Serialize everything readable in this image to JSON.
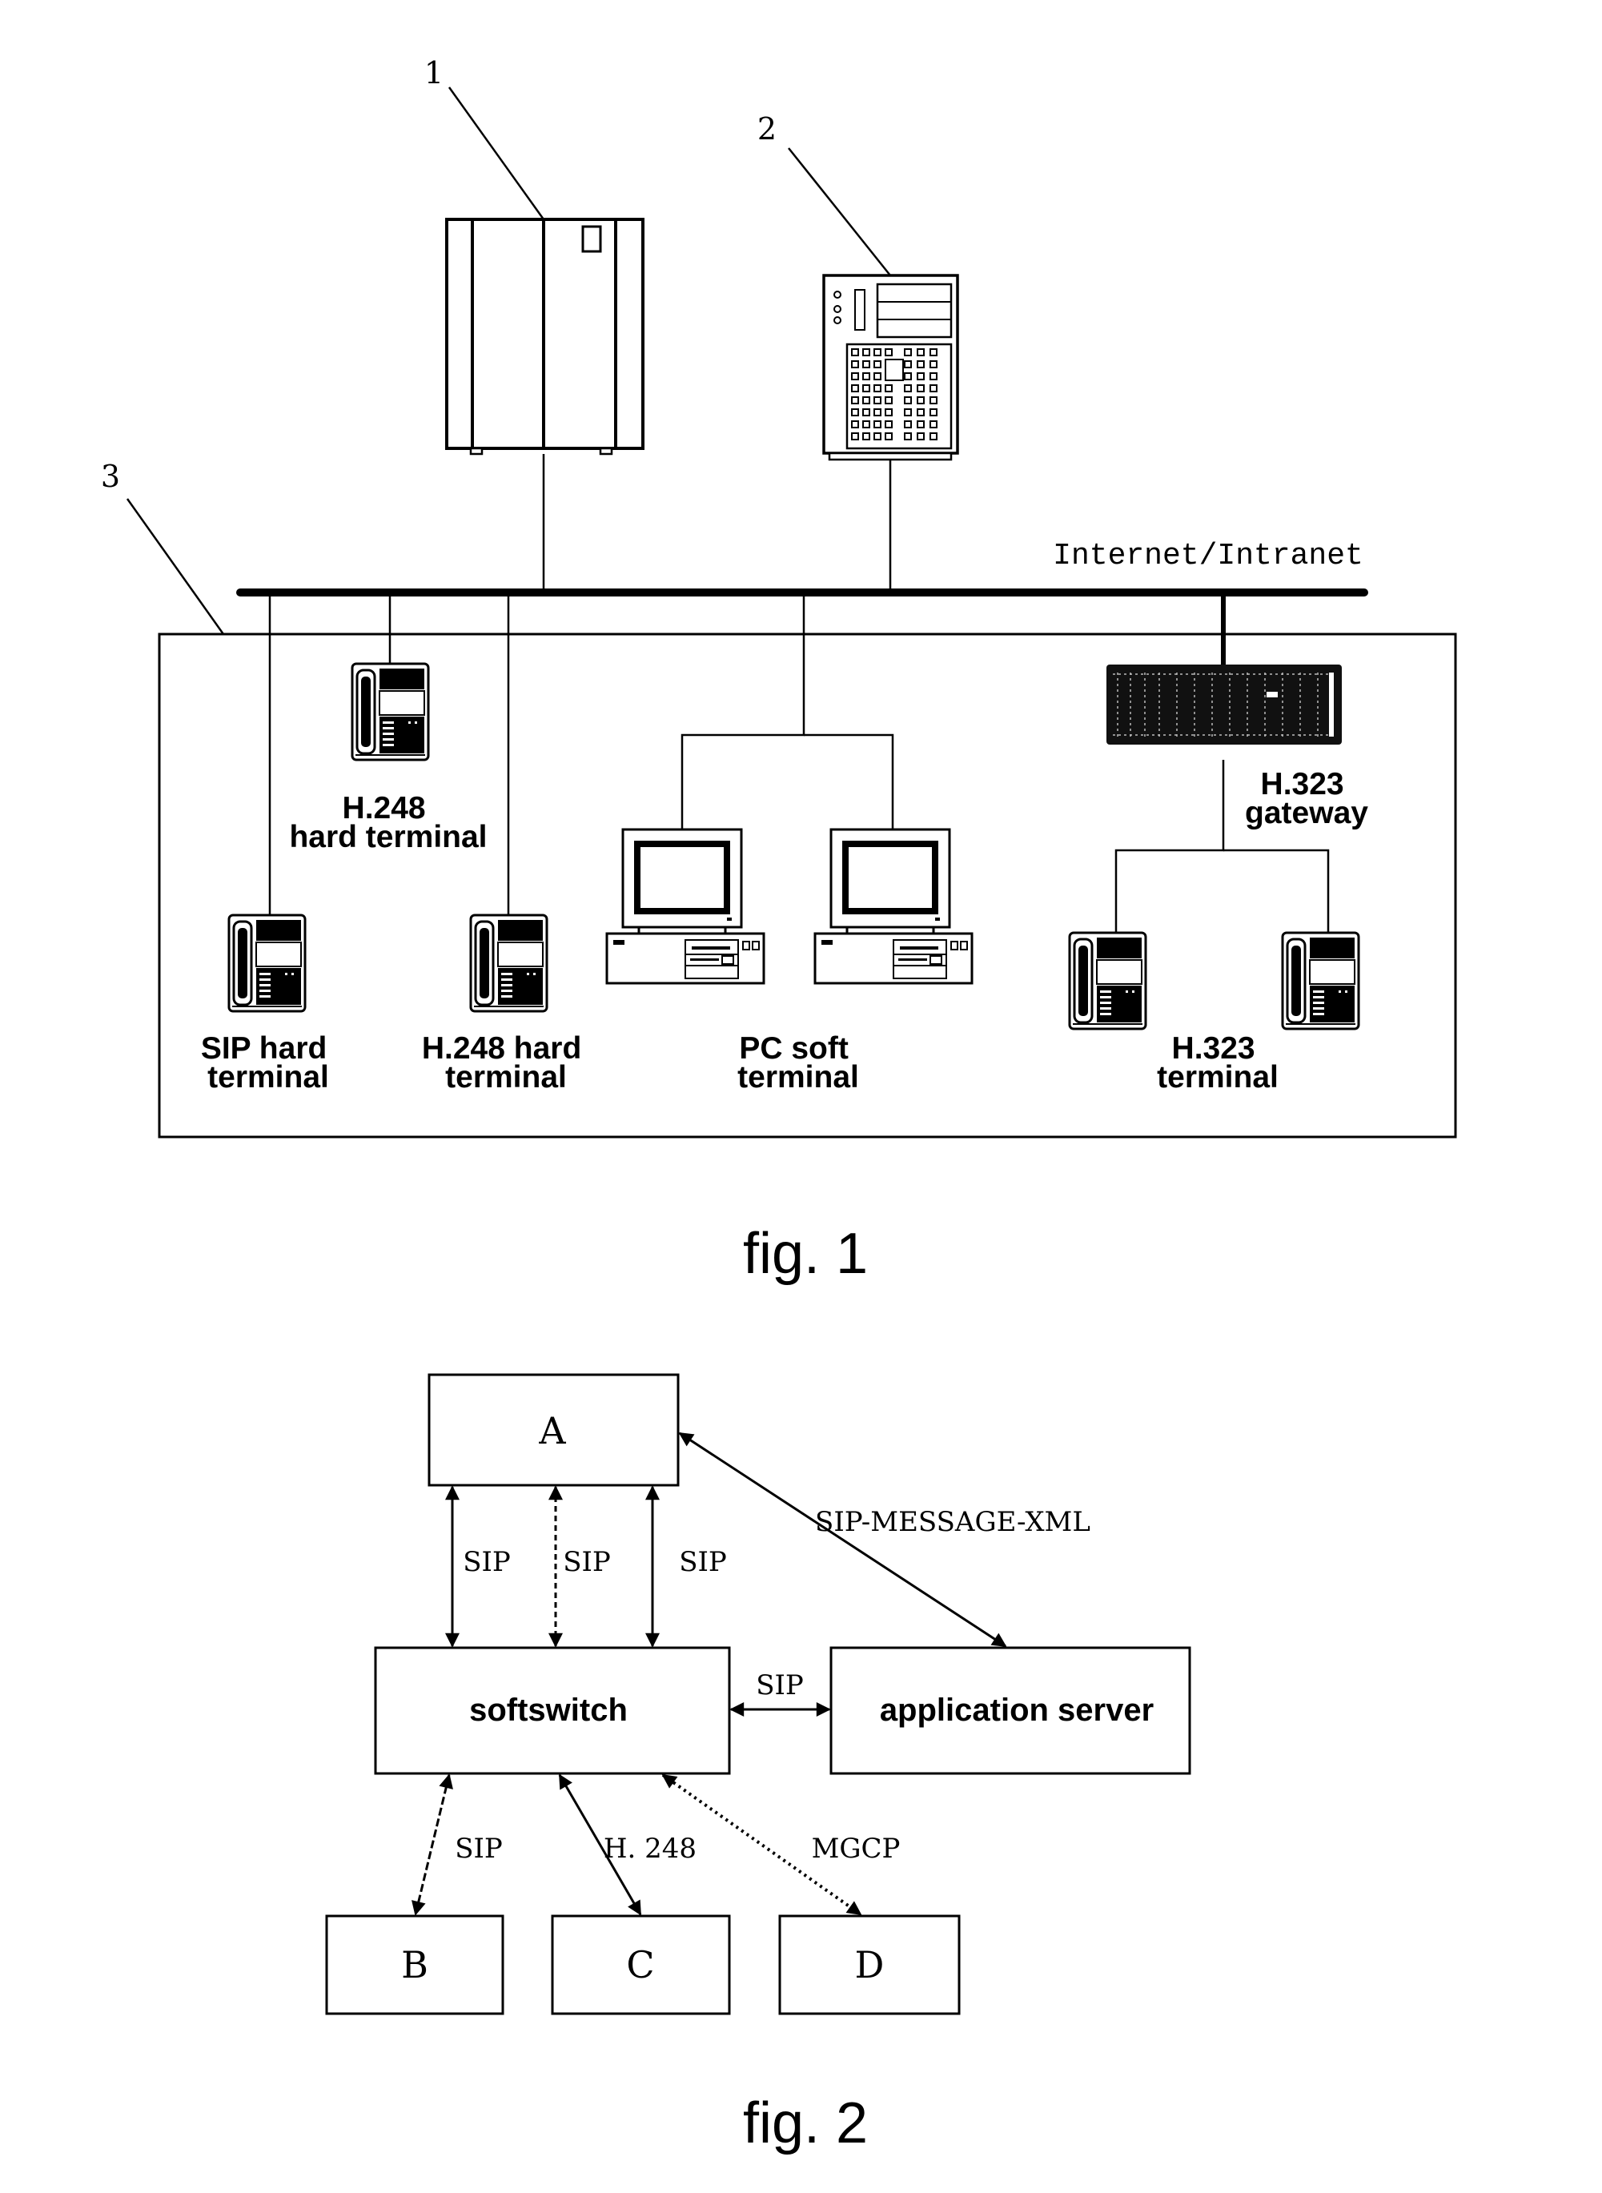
{
  "fig1": {
    "ref_labels": {
      "server1": "1",
      "server2": "2",
      "network": "3"
    },
    "network_label": "Internet/Intranet",
    "terminals": {
      "h248_top": [
        "H.248",
        "hard terminal"
      ],
      "sip_hard": [
        "SIP hard",
        "terminal"
      ],
      "h248_hard": [
        "H.248 hard",
        "terminal"
      ],
      "pc_soft": [
        "PC soft",
        "terminal"
      ],
      "h323_gateway": [
        "H.323",
        "gateway"
      ],
      "h323_terminal": [
        "H.323",
        "terminal"
      ]
    },
    "caption": "fig. 1"
  },
  "fig2": {
    "nodes": {
      "a": "A",
      "softswitch": "softswitch",
      "app_server": "application server",
      "b": "B",
      "c": "C",
      "d": "D"
    },
    "links": {
      "a_soft_1": "SIP",
      "a_soft_2": "SIP",
      "a_soft_3": "SIP",
      "a_app": "SIP-MESSAGE-XML",
      "soft_app": "SIP",
      "soft_b": "SIP",
      "soft_c": "H. 248",
      "soft_d": "MGCP"
    },
    "caption": "fig. 2"
  }
}
